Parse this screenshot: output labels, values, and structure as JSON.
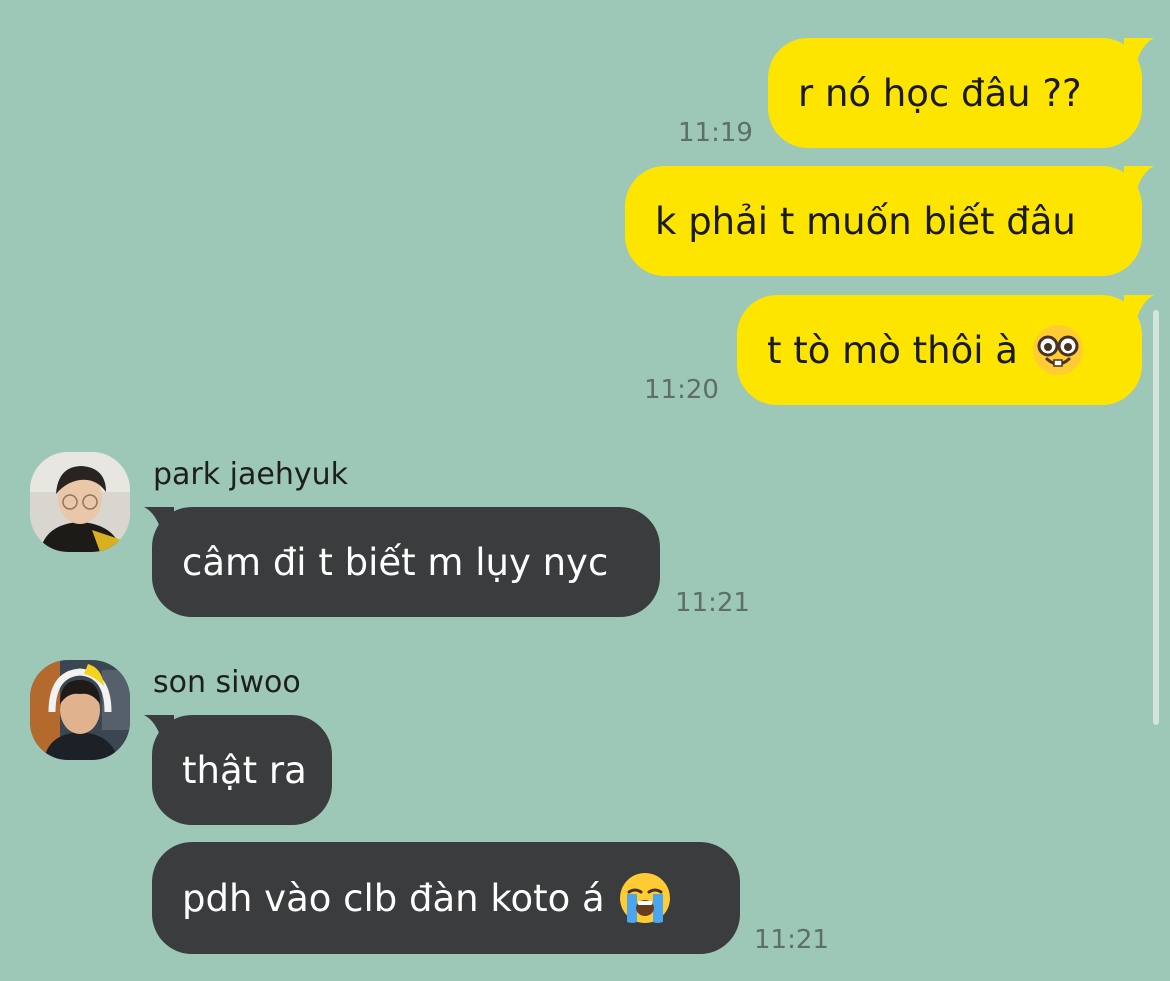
{
  "messages": {
    "m1": {
      "text": "r nó học đâu ??",
      "time": "11:19"
    },
    "m2": {
      "text": "k phải t muốn biết đâu"
    },
    "m3": {
      "text": "t tò mò thôi à",
      "emoji": "nerd-face-icon",
      "time": "11:20"
    },
    "m4": {
      "sender": "park jaehyuk",
      "text": "câm đi t biết m lụy nyc",
      "time": "11:21"
    },
    "m5": {
      "sender": "son siwoo",
      "text": "thật ra"
    },
    "m6": {
      "text": "pdh vào clb đàn koto á",
      "emoji": "loudly-crying-face-icon",
      "time": "11:21"
    }
  },
  "colors": {
    "background": "#9dc7b7",
    "outgoing_bubble": "#fee500",
    "incoming_bubble": "#3b3c3e",
    "timestamp": "#5d6f68"
  }
}
